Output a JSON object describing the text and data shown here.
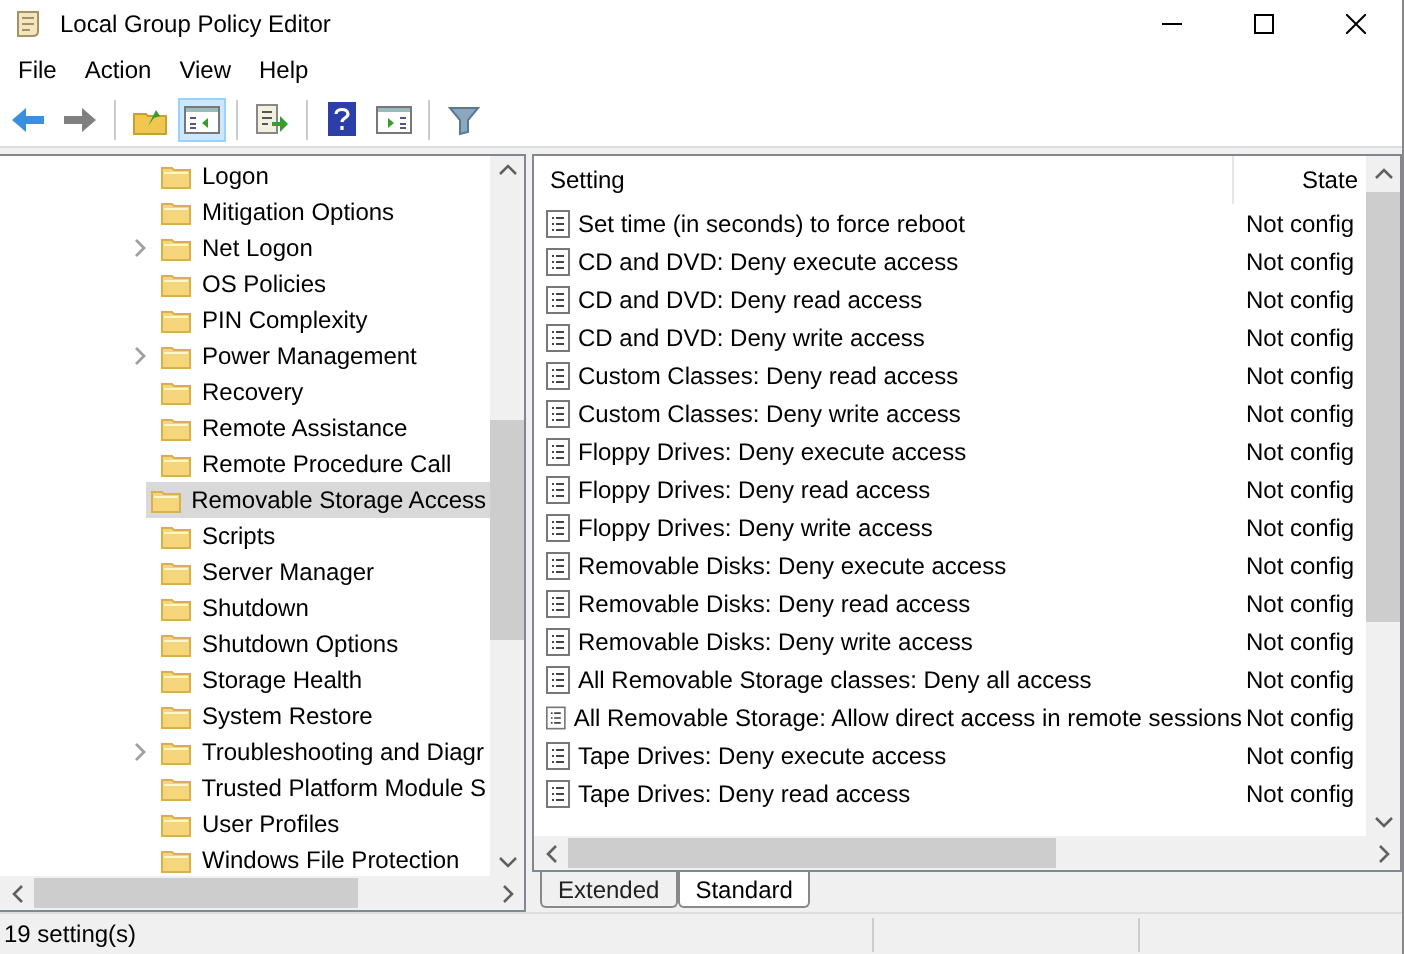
{
  "window": {
    "title": "Local Group Policy Editor"
  },
  "menu": [
    "File",
    "Action",
    "View",
    "Help"
  ],
  "toolbar": [
    {
      "kind": "back",
      "pressed": false
    },
    {
      "kind": "forward",
      "pressed": false
    },
    {
      "kind": "separator"
    },
    {
      "kind": "up",
      "pressed": false
    },
    {
      "kind": "tree",
      "pressed": true
    },
    {
      "kind": "separator"
    },
    {
      "kind": "export",
      "pressed": false
    },
    {
      "kind": "separator"
    },
    {
      "kind": "help",
      "pressed": false
    },
    {
      "kind": "actionpane",
      "pressed": false
    },
    {
      "kind": "separator"
    },
    {
      "kind": "filter",
      "pressed": false
    }
  ],
  "tree": {
    "items": [
      {
        "label": "Logon",
        "expandable": false,
        "selected": false
      },
      {
        "label": "Mitigation Options",
        "expandable": false,
        "selected": false
      },
      {
        "label": "Net Logon",
        "expandable": true,
        "selected": false
      },
      {
        "label": "OS Policies",
        "expandable": false,
        "selected": false
      },
      {
        "label": "PIN Complexity",
        "expandable": false,
        "selected": false
      },
      {
        "label": "Power Management",
        "expandable": true,
        "selected": false
      },
      {
        "label": "Recovery",
        "expandable": false,
        "selected": false
      },
      {
        "label": "Remote Assistance",
        "expandable": false,
        "selected": false
      },
      {
        "label": "Remote Procedure Call",
        "expandable": false,
        "selected": false
      },
      {
        "label": "Removable Storage Access",
        "expandable": false,
        "selected": true
      },
      {
        "label": "Scripts",
        "expandable": false,
        "selected": false
      },
      {
        "label": "Server Manager",
        "expandable": false,
        "selected": false
      },
      {
        "label": "Shutdown",
        "expandable": false,
        "selected": false
      },
      {
        "label": "Shutdown Options",
        "expandable": false,
        "selected": false
      },
      {
        "label": "Storage Health",
        "expandable": false,
        "selected": false
      },
      {
        "label": "System Restore",
        "expandable": false,
        "selected": false
      },
      {
        "label": "Troubleshooting and Diagr",
        "expandable": true,
        "selected": false
      },
      {
        "label": "Trusted Platform Module S",
        "expandable": false,
        "selected": false
      },
      {
        "label": "User Profiles",
        "expandable": false,
        "selected": false
      },
      {
        "label": "Windows File Protection",
        "expandable": false,
        "selected": false
      }
    ]
  },
  "table": {
    "columns": [
      "Setting",
      "State"
    ],
    "rows": [
      [
        "Set time (in seconds) to force reboot",
        "Not config"
      ],
      [
        "CD and DVD: Deny execute access",
        "Not config"
      ],
      [
        "CD and DVD: Deny read access",
        "Not config"
      ],
      [
        "CD and DVD: Deny write access",
        "Not config"
      ],
      [
        "Custom Classes: Deny read access",
        "Not config"
      ],
      [
        "Custom Classes: Deny write access",
        "Not config"
      ],
      [
        "Floppy Drives: Deny execute access",
        "Not config"
      ],
      [
        "Floppy Drives: Deny read access",
        "Not config"
      ],
      [
        "Floppy Drives: Deny write access",
        "Not config"
      ],
      [
        "Removable Disks: Deny execute access",
        "Not config"
      ],
      [
        "Removable Disks: Deny read access",
        "Not config"
      ],
      [
        "Removable Disks: Deny write access",
        "Not config"
      ],
      [
        "All Removable Storage classes: Deny all access",
        "Not config"
      ],
      [
        "All Removable Storage: Allow direct access in remote sessions",
        "Not config"
      ],
      [
        "Tape Drives: Deny execute access",
        "Not config"
      ],
      [
        "Tape Drives: Deny read access",
        "Not config"
      ]
    ]
  },
  "tabs": [
    {
      "label": "Extended",
      "selected": false
    },
    {
      "label": "Standard",
      "selected": true
    }
  ],
  "status_bar": {
    "text": "19 setting(s)"
  }
}
